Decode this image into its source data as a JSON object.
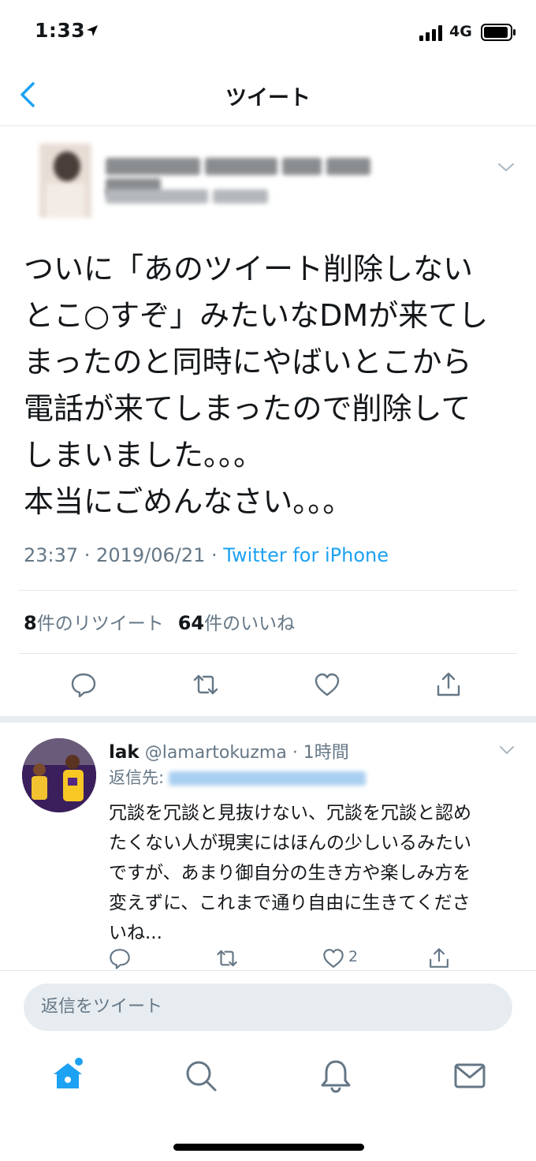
{
  "status_bar": {
    "time": "1:33",
    "network": "4G"
  },
  "nav": {
    "title": "ツイート"
  },
  "tweet": {
    "text": "ついに「あのツイート削除しない\nとこ○すぞ」みたいなDMが来てし\nまったのと同時にやばいとこから\n電話が来てしまったので削除して\nしまいました。。。\n本当にごめんなさい。。。",
    "time": "23:37 · 2019/06/21 · ",
    "source": "Twitter for iPhone",
    "retweet_count": "8",
    "retweet_label": "件のリツイート",
    "like_count": "64",
    "like_label": "件のいいね"
  },
  "reply": {
    "name": "lak",
    "handle": "@lamartokuzma",
    "time": "· 1時間",
    "reply_to_label": "返信先:",
    "text": "冗談を冗談と見抜けない、冗談を冗談と認め\nたくない人が現実にはほんの少しいるみたい\nですが、あまり御自分の生き方や楽しみ方を\n変えずに、これまで通り自由に生きてくださ\nいね...",
    "like_count": "2"
  },
  "composer": {
    "placeholder": "返信をツイート"
  },
  "colors": {
    "accent": "#1da1f2",
    "muted": "#657786",
    "divider": "#e1e8ed"
  },
  "icons": {
    "actions": [
      "reply-icon",
      "retweet-icon",
      "like-icon",
      "share-icon"
    ],
    "tabs": [
      "home-icon",
      "search-icon",
      "notifications-icon",
      "messages-icon"
    ]
  }
}
